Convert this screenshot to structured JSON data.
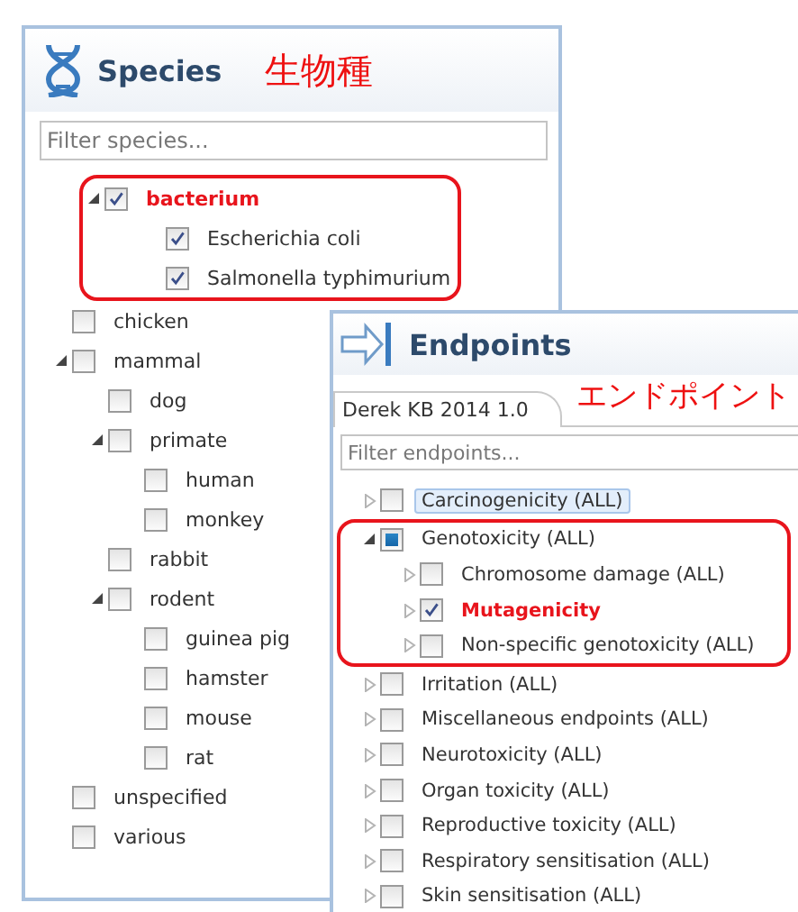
{
  "species": {
    "title": "Species",
    "note": "生物種",
    "filter": {
      "placeholder": "Filter species..."
    },
    "tree": [
      {
        "label": "bacterium",
        "checked": true,
        "emphasized": true,
        "boxed": true,
        "selected": false,
        "expanded": true,
        "children": [
          {
            "label": "Escherichia coli",
            "checked": true,
            "emphasized": false,
            "boxed": false,
            "selected": false
          },
          {
            "label": "Salmonella typhimurium",
            "checked": true,
            "emphasized": false,
            "boxed": false,
            "selected": false
          }
        ]
      },
      {
        "label": "chicken",
        "checked": false,
        "emphasized": false,
        "boxed": false,
        "selected": false
      },
      {
        "label": "mammal",
        "checked": false,
        "emphasized": false,
        "boxed": false,
        "selected": false,
        "expanded": true,
        "children": [
          {
            "label": "dog",
            "checked": false,
            "emphasized": false,
            "boxed": false,
            "selected": false
          },
          {
            "label": "primate",
            "checked": false,
            "emphasized": false,
            "boxed": false,
            "selected": false,
            "expanded": true,
            "children": [
              {
                "label": "human",
                "checked": false,
                "emphasized": false,
                "boxed": false,
                "selected": false
              },
              {
                "label": "monkey",
                "checked": false,
                "emphasized": false,
                "boxed": false,
                "selected": false
              }
            ]
          },
          {
            "label": "rabbit",
            "checked": false,
            "emphasized": false,
            "boxed": false,
            "selected": false
          },
          {
            "label": "rodent",
            "checked": false,
            "emphasized": false,
            "boxed": false,
            "selected": false,
            "expanded": true,
            "children": [
              {
                "label": "guinea pig",
                "checked": false,
                "emphasized": false,
                "boxed": false,
                "selected": false
              },
              {
                "label": "hamster",
                "checked": false,
                "emphasized": false,
                "boxed": false,
                "selected": false
              },
              {
                "label": "mouse",
                "checked": false,
                "emphasized": false,
                "boxed": false,
                "selected": false
              },
              {
                "label": "rat",
                "checked": false,
                "emphasized": false,
                "boxed": false,
                "selected": false
              }
            ]
          }
        ]
      },
      {
        "label": "unspecified",
        "checked": false,
        "emphasized": false,
        "boxed": false,
        "selected": false
      },
      {
        "label": "various",
        "checked": false,
        "emphasized": false,
        "boxed": false,
        "selected": false
      }
    ]
  },
  "endpoints": {
    "title": "Endpoints",
    "note": "エンドポイント",
    "tabs": [
      {
        "label": "Derek KB 2014 1.0",
        "selected": true
      }
    ],
    "filter": {
      "placeholder": "Filter endpoints..."
    },
    "tree": [
      {
        "label": "Carcinogenicity (ALL)",
        "checked": false,
        "indeterminate": false,
        "emphasized": false,
        "boxed": false,
        "selected": true,
        "expanded": false
      },
      {
        "label": "Genotoxicity (ALL)",
        "checked": false,
        "indeterminate": true,
        "emphasized": false,
        "boxed": true,
        "selected": false,
        "expanded": true,
        "children": [
          {
            "label": "Chromosome damage (ALL)",
            "checked": false,
            "indeterminate": false,
            "emphasized": false,
            "boxed": false,
            "selected": false,
            "expanded": false
          },
          {
            "label": "Mutagenicity",
            "checked": true,
            "indeterminate": false,
            "emphasized": true,
            "boxed": false,
            "selected": false,
            "expanded": false
          },
          {
            "label": "Non-specific genotoxicity (ALL)",
            "checked": false,
            "indeterminate": false,
            "emphasized": false,
            "boxed": false,
            "selected": false,
            "expanded": false
          }
        ]
      },
      {
        "label": "Irritation (ALL)",
        "checked": false,
        "indeterminate": false,
        "emphasized": false,
        "boxed": false,
        "selected": false,
        "expanded": false
      },
      {
        "label": "Miscellaneous endpoints (ALL)",
        "checked": false,
        "indeterminate": false,
        "emphasized": false,
        "boxed": false,
        "selected": false,
        "expanded": false
      },
      {
        "label": "Neurotoxicity (ALL)",
        "checked": false,
        "indeterminate": false,
        "emphasized": false,
        "boxed": false,
        "selected": false,
        "expanded": false
      },
      {
        "label": "Organ toxicity (ALL)",
        "checked": false,
        "indeterminate": false,
        "emphasized": false,
        "boxed": false,
        "selected": false,
        "expanded": false
      },
      {
        "label": "Reproductive toxicity (ALL)",
        "checked": false,
        "indeterminate": false,
        "emphasized": false,
        "boxed": false,
        "selected": false,
        "expanded": false
      },
      {
        "label": "Respiratory sensitisation (ALL)",
        "checked": false,
        "indeterminate": false,
        "emphasized": false,
        "boxed": false,
        "selected": false,
        "expanded": false
      },
      {
        "label": "Skin sensitisation (ALL)",
        "checked": false,
        "indeterminate": false,
        "emphasized": false,
        "boxed": false,
        "selected": false,
        "expanded": false
      }
    ]
  }
}
